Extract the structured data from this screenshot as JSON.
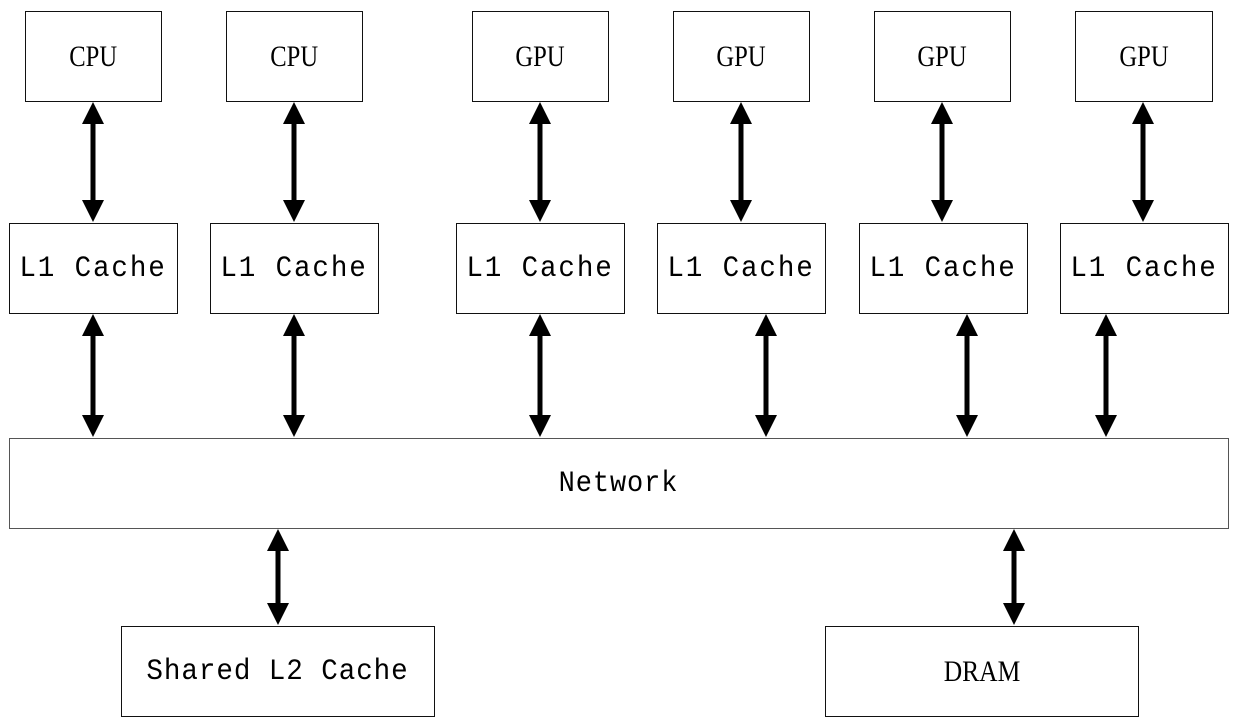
{
  "diagram": {
    "processors": [
      {
        "label": "CPU",
        "type": "cpu"
      },
      {
        "label": "CPU",
        "type": "cpu"
      },
      {
        "label": "GPU",
        "type": "gpu"
      },
      {
        "label": "GPU",
        "type": "gpu"
      },
      {
        "label": "GPU",
        "type": "gpu"
      },
      {
        "label": "GPU",
        "type": "gpu"
      }
    ],
    "l1_caches": [
      {
        "label": "L1 Cache"
      },
      {
        "label": "L1 Cache"
      },
      {
        "label": "L1 Cache"
      },
      {
        "label": "L1 Cache"
      },
      {
        "label": "L1 Cache"
      },
      {
        "label": "L1 Cache"
      }
    ],
    "network": {
      "label": "Network"
    },
    "shared_l2": {
      "label": "Shared L2 Cache"
    },
    "dram": {
      "label": "DRAM"
    },
    "connections": [
      {
        "from": "processor-1",
        "to": "l1-cache-1",
        "direction": "bidirectional"
      },
      {
        "from": "processor-2",
        "to": "l1-cache-2",
        "direction": "bidirectional"
      },
      {
        "from": "processor-3",
        "to": "l1-cache-3",
        "direction": "bidirectional"
      },
      {
        "from": "processor-4",
        "to": "l1-cache-4",
        "direction": "bidirectional"
      },
      {
        "from": "processor-5",
        "to": "l1-cache-5",
        "direction": "bidirectional"
      },
      {
        "from": "processor-6",
        "to": "l1-cache-6",
        "direction": "bidirectional"
      },
      {
        "from": "l1-cache-1",
        "to": "network",
        "direction": "bidirectional"
      },
      {
        "from": "l1-cache-2",
        "to": "network",
        "direction": "bidirectional"
      },
      {
        "from": "l1-cache-3",
        "to": "network",
        "direction": "bidirectional"
      },
      {
        "from": "l1-cache-4",
        "to": "network",
        "direction": "bidirectional"
      },
      {
        "from": "l1-cache-5",
        "to": "network",
        "direction": "bidirectional"
      },
      {
        "from": "l1-cache-6",
        "to": "network",
        "direction": "bidirectional"
      },
      {
        "from": "network",
        "to": "shared-l2-cache",
        "direction": "bidirectional"
      },
      {
        "from": "network",
        "to": "dram",
        "direction": "bidirectional"
      }
    ]
  }
}
